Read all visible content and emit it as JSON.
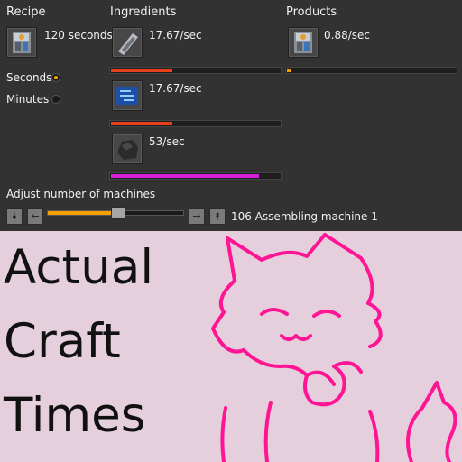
{
  "headers": {
    "recipe": "Recipe",
    "ingredients": "Ingredients",
    "products": "Products"
  },
  "recipe": {
    "time_label": "120 seconds",
    "icon": "satellite-icon"
  },
  "time_unit": {
    "options": [
      {
        "label": "Seconds",
        "selected": true
      },
      {
        "label": "Minutes",
        "selected": false
      }
    ]
  },
  "ingredients": [
    {
      "icon": "low-density-structure-icon",
      "rate": "17.67/sec",
      "bar_fraction": 0.37,
      "bar_color": "#e8401a"
    },
    {
      "icon": "processing-unit-icon",
      "rate": "17.67/sec",
      "bar_fraction": 0.37,
      "bar_color": "#e8401a"
    },
    {
      "icon": "coal-icon",
      "rate": "53/sec",
      "bar_fraction": 0.88,
      "bar_color": "#d420d8"
    }
  ],
  "products": [
    {
      "icon": "satellite-icon",
      "rate": "0.88/sec",
      "bar_fraction": 0.03,
      "bar_color": "#f5a000"
    }
  ],
  "machines": {
    "label": "Adjust number of machines",
    "value_text": "106 Assembling machine 1",
    "slider_fraction": 0.52,
    "slider_color": "#f5a000"
  },
  "caption": {
    "line1": "Actual",
    "line2": "Craft",
    "line3": "Times"
  }
}
